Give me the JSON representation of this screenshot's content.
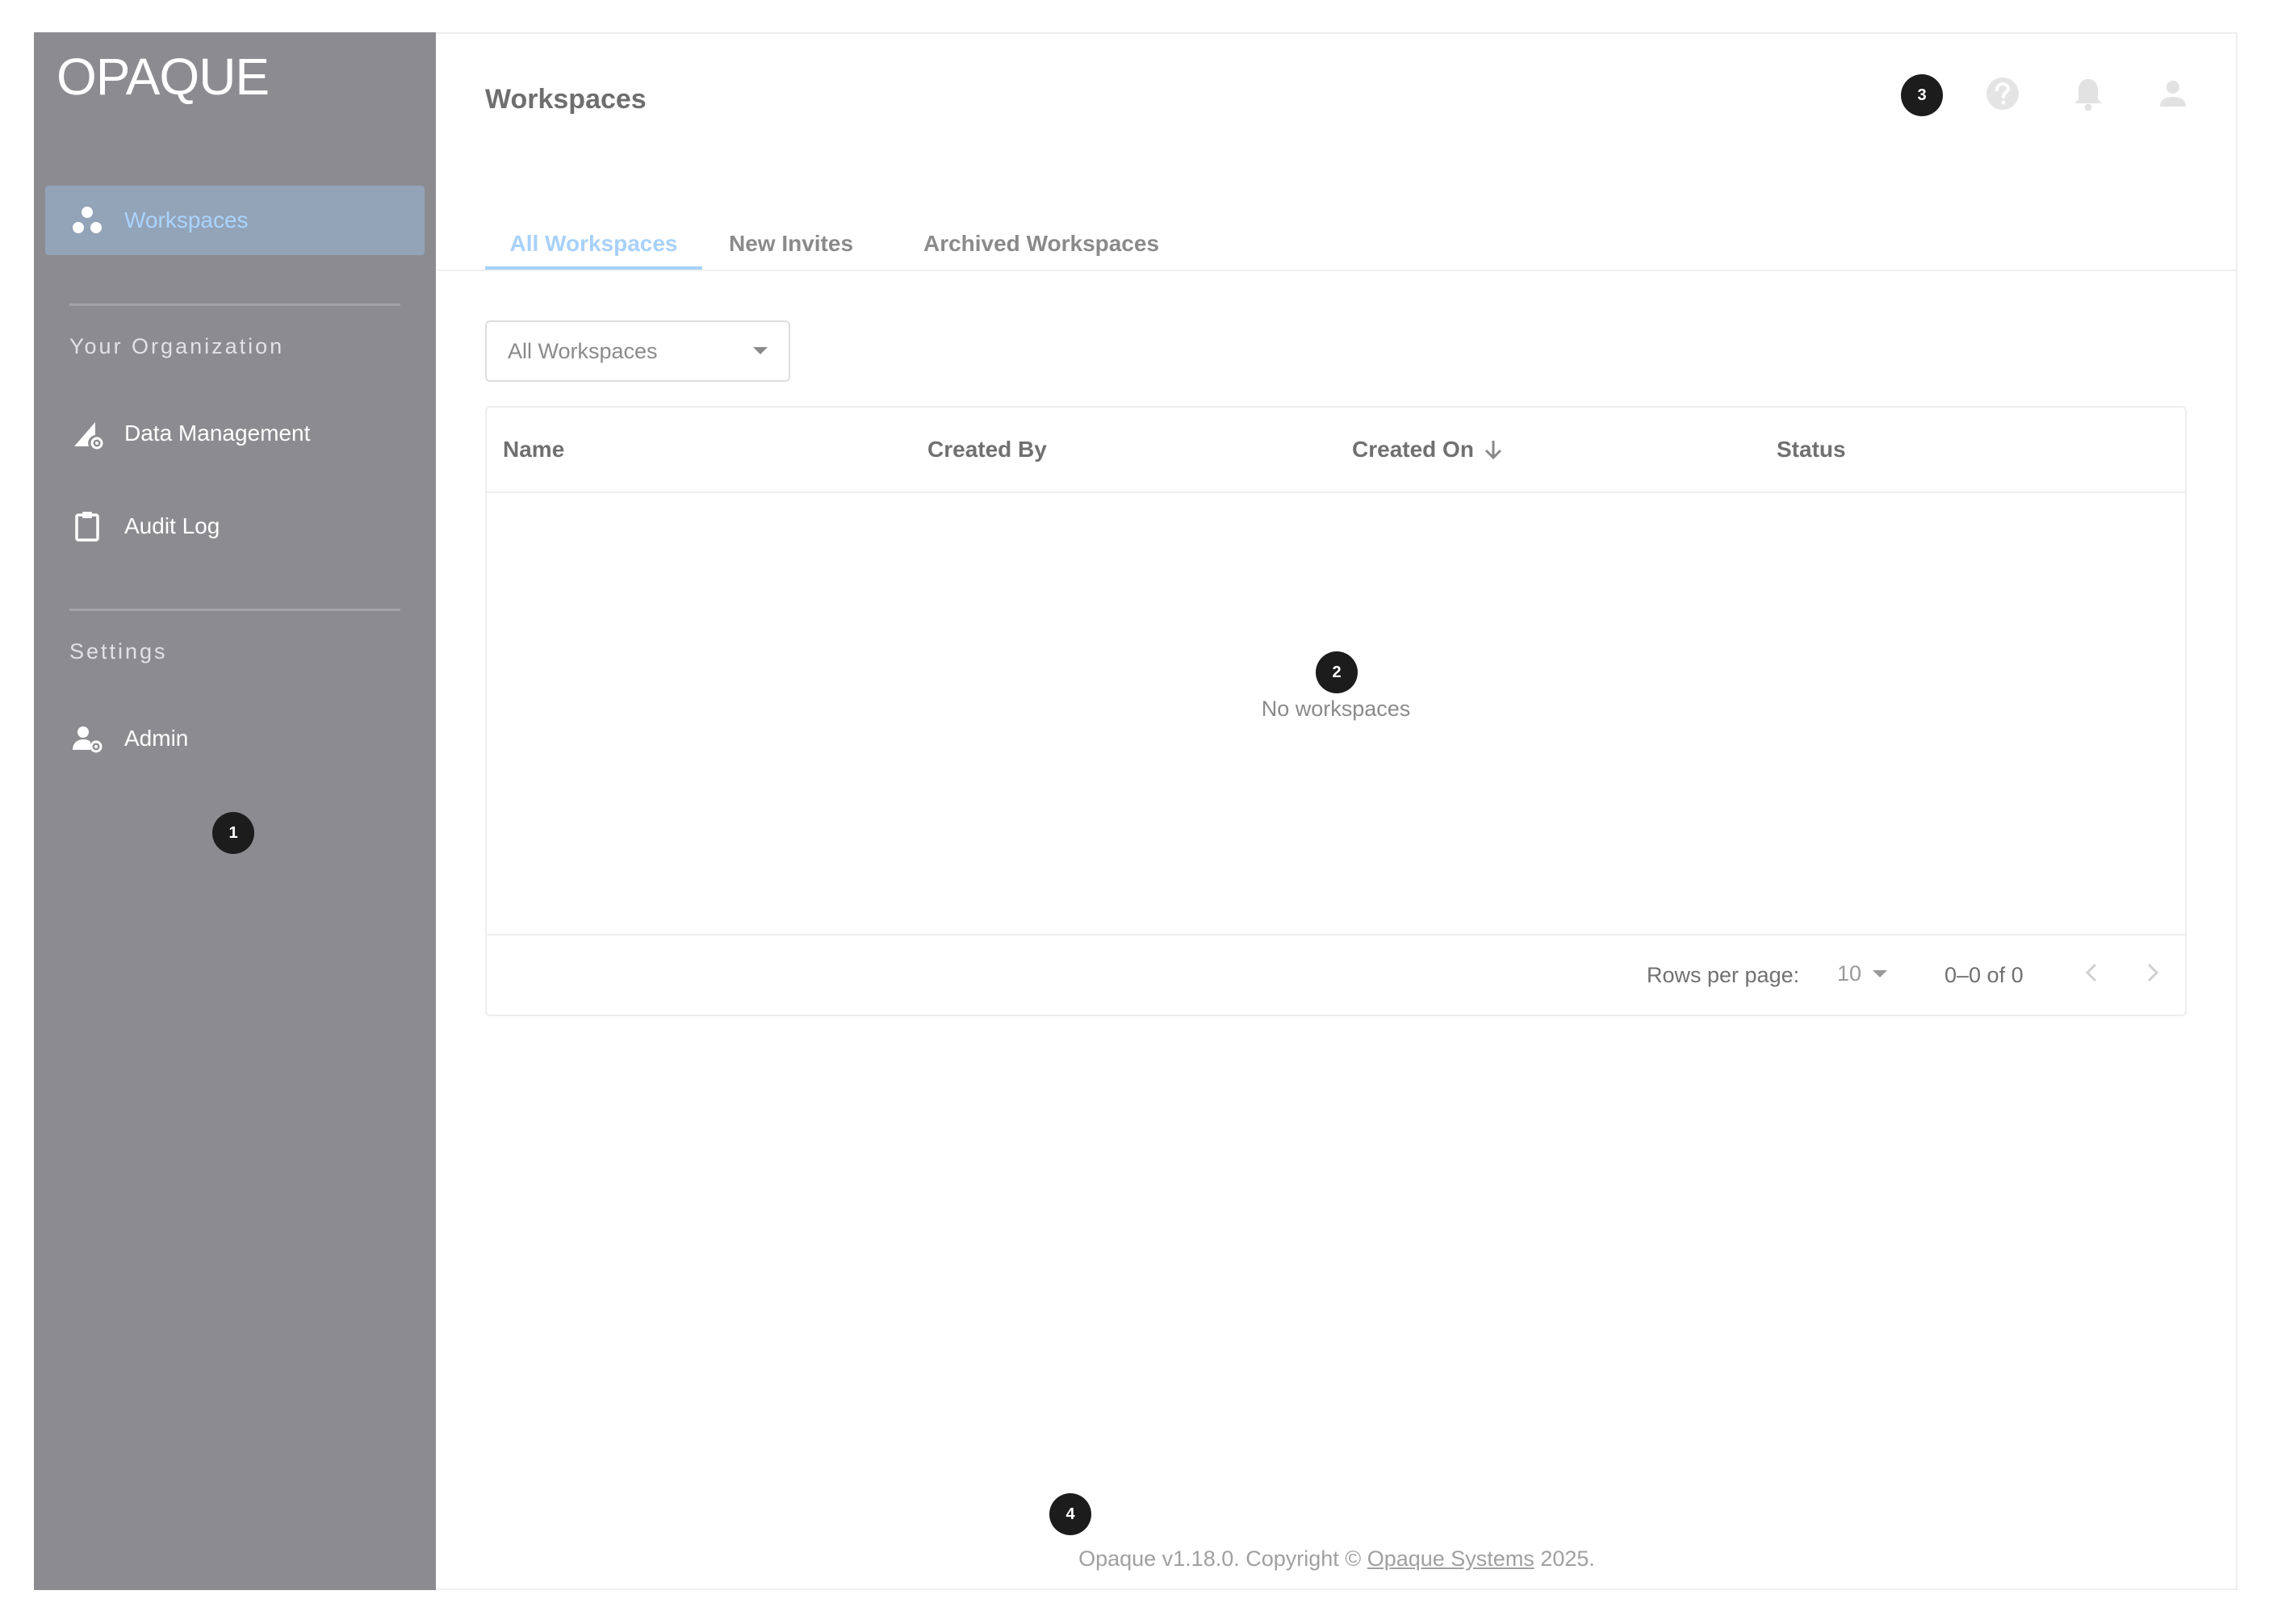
{
  "app": {
    "logo": "OPAQUE",
    "page_title": "Workspaces"
  },
  "sidebar": {
    "items": [
      {
        "label": "Workspaces",
        "icon": "workspaces-icon",
        "active": true
      },
      {
        "label": "Data Management",
        "icon": "data-management-icon",
        "active": false
      },
      {
        "label": "Audit Log",
        "icon": "clipboard-icon",
        "active": false
      },
      {
        "label": "Admin",
        "icon": "admin-icon",
        "active": false
      }
    ],
    "sections": [
      "Your Organization",
      "Settings"
    ]
  },
  "tabs": [
    {
      "label": "All Workspaces",
      "active": true
    },
    {
      "label": "New Invites",
      "active": false
    },
    {
      "label": "Archived Workspaces",
      "active": false
    }
  ],
  "filter": {
    "selected": "All Workspaces"
  },
  "table": {
    "columns": [
      "Name",
      "Created By",
      "Created On",
      "Status"
    ],
    "sort_column": "Created On",
    "sort_direction": "descending",
    "empty_message": "No workspaces",
    "rows_per_page_label": "Rows per page:",
    "rows_per_page_value": "10",
    "range_text": "0–0 of 0"
  },
  "badges": [
    "1",
    "2",
    "3",
    "4"
  ],
  "footer": {
    "prefix": "Opaque v1.18.0. Copyright ©",
    "link": "Opaque Systems",
    "suffix": "2025."
  },
  "colors": {
    "sidebar_bg": "#8c8c90",
    "accent": "#a7d1fb",
    "active_nav_bg": "#93a3b8"
  }
}
